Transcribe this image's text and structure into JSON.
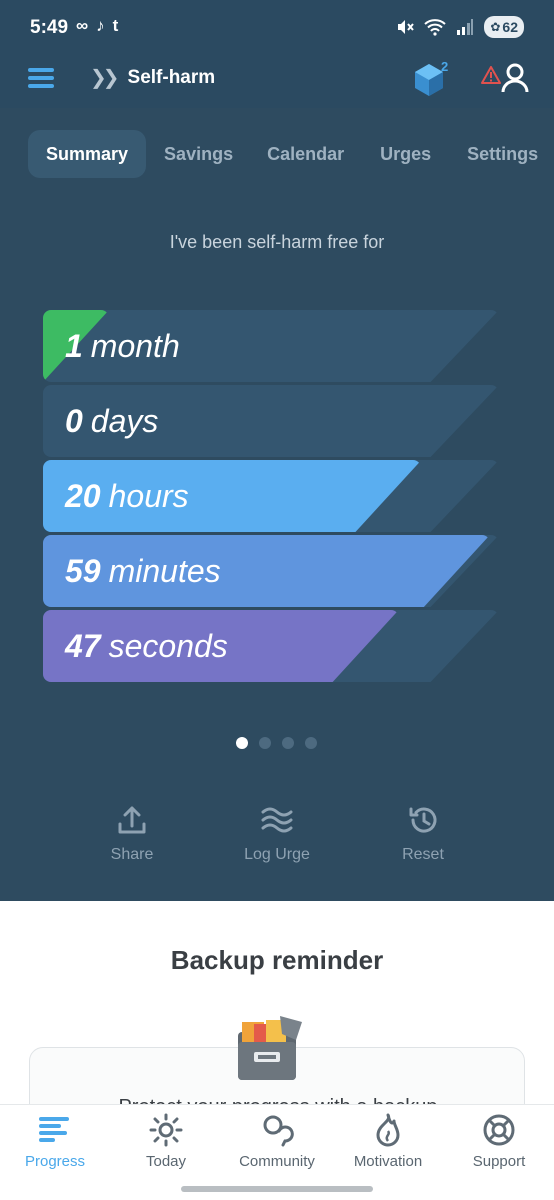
{
  "status_bar": {
    "time": "5:49",
    "apps": [
      "∞",
      "♪",
      "t"
    ],
    "battery": "62"
  },
  "app_bar": {
    "title": "Self-harm",
    "gem_count": "2"
  },
  "tabs": [
    {
      "label": "Summary",
      "active": true
    },
    {
      "label": "Savings",
      "active": false
    },
    {
      "label": "Calendar",
      "active": false
    },
    {
      "label": "Urges",
      "active": false
    },
    {
      "label": "Settings",
      "active": false
    }
  ],
  "summary": {
    "subtitle": "I've been self-harm free for",
    "counters": [
      {
        "value": "1",
        "unit": "month",
        "fraction": 0.1,
        "color": "#3dbb63"
      },
      {
        "value": "0",
        "unit": "days",
        "fraction": 0.0,
        "color": "#5aaef0"
      },
      {
        "value": "20",
        "unit": "hours",
        "fraction": 0.83,
        "color": "#5aaef0"
      },
      {
        "value": "59",
        "unit": "minutes",
        "fraction": 0.98,
        "color": "#5f95de"
      },
      {
        "value": "47",
        "unit": "seconds",
        "fraction": 0.78,
        "color": "#7674c6"
      }
    ],
    "pages": 4,
    "current_page": 1
  },
  "actions": {
    "share": "Share",
    "log_urge": "Log Urge",
    "reset": "Reset"
  },
  "backup": {
    "title": "Backup reminder",
    "text": "Protect your progress with a backup"
  },
  "bottom_nav": [
    {
      "label": "Progress",
      "icon": "progress-icon",
      "active": true
    },
    {
      "label": "Today",
      "icon": "sun-icon",
      "active": false
    },
    {
      "label": "Community",
      "icon": "chat-bubbles-icon",
      "active": false
    },
    {
      "label": "Motivation",
      "icon": "flame-icon",
      "active": false
    },
    {
      "label": "Support",
      "icon": "lifebuoy-icon",
      "active": false
    }
  ],
  "colors": {
    "panel": "#2e4b60",
    "accent": "#4aa8ea"
  }
}
